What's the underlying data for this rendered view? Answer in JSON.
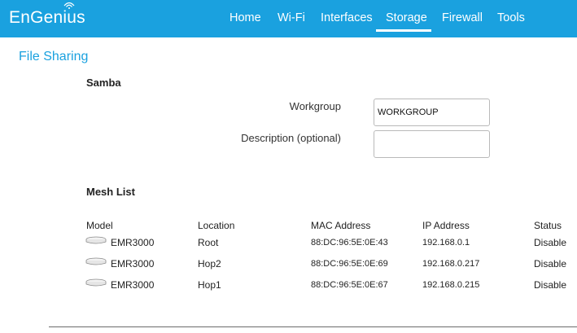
{
  "brand": {
    "logo_text": "EnGenius"
  },
  "nav": {
    "items": [
      {
        "label": "Home"
      },
      {
        "label": "Wi-Fi"
      },
      {
        "label": "Interfaces"
      },
      {
        "label": "Storage",
        "active": true
      },
      {
        "label": "Firewall"
      },
      {
        "label": "Tools"
      }
    ]
  },
  "page": {
    "title": "File Sharing"
  },
  "samba": {
    "title": "Samba",
    "workgroup": {
      "label": "Workgroup",
      "value": "WORKGROUP"
    },
    "description": {
      "label": "Description (optional)",
      "value": ""
    }
  },
  "mesh": {
    "title": "Mesh List",
    "headers": [
      "Model",
      "Location",
      "MAC Address",
      "IP Address",
      "Status"
    ],
    "rows": [
      {
        "model": "EMR3000",
        "location": "Root",
        "mac": "88:DC:96:5E:0E:43",
        "ip": "192.168.0.1",
        "status": "Disable"
      },
      {
        "model": "EMR3000",
        "location": "Hop2",
        "mac": "88:DC:96:5E:0E:69",
        "ip": "192.168.0.217",
        "status": "Disable"
      },
      {
        "model": "EMR3000",
        "location": "Hop1",
        "mac": "88:DC:96:5E:0E:67",
        "ip": "192.168.0.215",
        "status": "Disable"
      }
    ]
  },
  "colors": {
    "accent": "#1aa1df",
    "white": "#ffffff"
  },
  "icons": {
    "device": "router-device-icon",
    "wifi": "wifi-arc-icon"
  }
}
